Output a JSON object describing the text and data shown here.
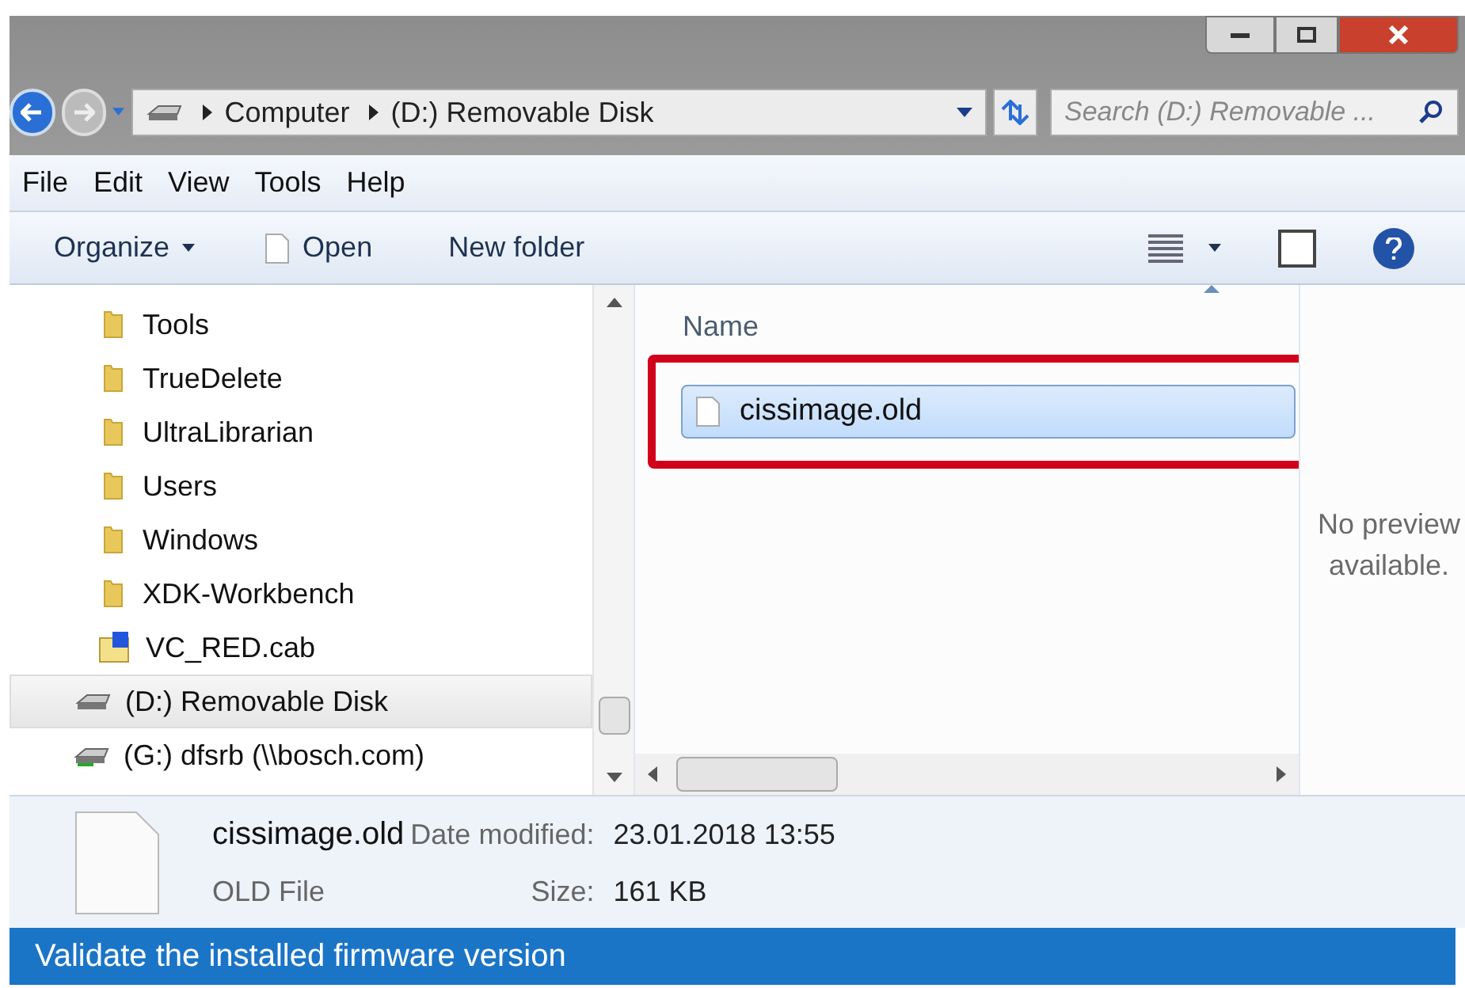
{
  "address_bar": {
    "crumbs": [
      "Computer",
      "(D:) Removable Disk"
    ]
  },
  "search": {
    "placeholder": "Search (D:) Removable ..."
  },
  "menu": [
    "File",
    "Edit",
    "View",
    "Tools",
    "Help"
  ],
  "toolbar": {
    "organize": "Organize",
    "open": "Open",
    "new_folder": "New folder"
  },
  "nav_items": [
    {
      "kind": "folder",
      "label": "Tools",
      "selected": false
    },
    {
      "kind": "folder",
      "label": "TrueDelete",
      "selected": false
    },
    {
      "kind": "folder",
      "label": "UltraLibrarian",
      "selected": false
    },
    {
      "kind": "folder",
      "label": "Users",
      "selected": false
    },
    {
      "kind": "folder",
      "label": "Windows",
      "selected": false
    },
    {
      "kind": "folder",
      "label": "XDK-Workbench",
      "selected": false
    },
    {
      "kind": "cab",
      "label": "VC_RED.cab",
      "selected": false
    },
    {
      "kind": "drive",
      "label": "(D:) Removable Disk",
      "selected": true
    },
    {
      "kind": "network",
      "label": "(G:) dfsrb (\\\\bosch.com)",
      "selected": false
    }
  ],
  "file_list": {
    "column": "Name",
    "files": [
      {
        "name": "cissimage.old",
        "selected": true,
        "highlighted": true
      }
    ]
  },
  "preview": {
    "text": "No preview available."
  },
  "details": {
    "name": "cissimage.old",
    "type": "OLD File",
    "date_label": "Date modified:",
    "date": "23.01.2018 13:55",
    "size_label": "Size:",
    "size": "161 KB"
  },
  "caption": "Validate the installed firmware version"
}
